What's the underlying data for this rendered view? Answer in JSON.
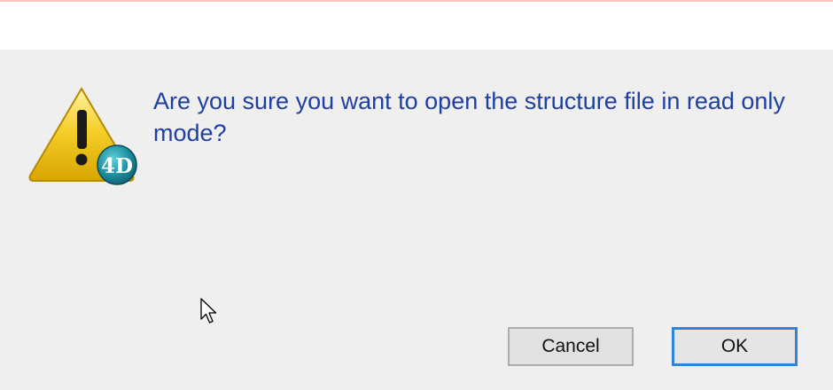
{
  "dialog": {
    "message": "Are you sure you want to open the structure file in read only mode?",
    "icon": "warning-4d-icon",
    "badge_text": "4D",
    "cancel_label": "Cancel",
    "ok_label": "OK"
  },
  "colors": {
    "message_text": "#1f3fa2",
    "background": "#efefef",
    "focus_border": "#2f83d8",
    "warning_yellow": "#f2c200",
    "badge_teal": "#1d8fa0"
  }
}
